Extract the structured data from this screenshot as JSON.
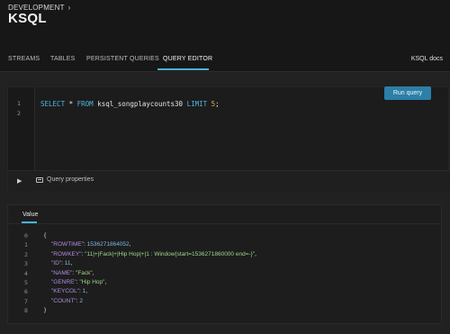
{
  "header": {
    "breadcrumb": "DEVELOPMENT",
    "title": "KSQL",
    "tabs": [
      {
        "label": "STREAMS"
      },
      {
        "label": "TABLES"
      },
      {
        "label": "PERSISTENT QUERIES"
      },
      {
        "label": "QUERY EDITOR"
      }
    ],
    "docs_label": "KSQL docs"
  },
  "editor": {
    "line_numbers": [
      "1",
      "2"
    ],
    "query_parts": {
      "kw1": "SELECT",
      "mid1": " * ",
      "kw2": "FROM",
      "table": " ksql_songplaycounts30 ",
      "kw3": "LIMIT",
      "space": " ",
      "limit": "5",
      "end": ";"
    },
    "query_properties_label": "Query properties",
    "run_label": "Run query"
  },
  "results": {
    "tab_label": "Value",
    "line_numbers": [
      "0",
      "1",
      "2",
      "3",
      "4",
      "5",
      "6",
      "7",
      "8"
    ],
    "lines": [
      {
        "text": "{"
      },
      {
        "key": "\"ROWTIME\"",
        "sep": ": ",
        "val": "1536271864052",
        "type": "n",
        "tail": ","
      },
      {
        "key": "\"ROWKEY\"",
        "sep": ": ",
        "val": "\"11|+|Fack|+|Hip Hop|+|1 : Window{start=1536271860000 end=-}\"",
        "type": "s",
        "tail": ","
      },
      {
        "key": "\"ID\"",
        "sep": ": ",
        "val": "11",
        "type": "n",
        "tail": ","
      },
      {
        "key": "\"NAME\"",
        "sep": ": ",
        "val": "\"Fack\"",
        "type": "s",
        "tail": ","
      },
      {
        "key": "\"GENRE\"",
        "sep": ": ",
        "val": "\"Hip Hop\"",
        "type": "s",
        "tail": ","
      },
      {
        "key": "\"KEYCOL\"",
        "sep": ": ",
        "val": "1",
        "type": "n",
        "tail": ","
      },
      {
        "key": "\"COUNT\"",
        "sep": ": ",
        "val": "2",
        "type": "n",
        "tail": ""
      },
      {
        "text": "}"
      }
    ]
  },
  "colors": {
    "accent": "#49b4d6",
    "run_button": "#2b7fa8",
    "keyword": "#4fb6df",
    "number_literal": "#d7b04f"
  },
  "icons": {
    "breadcrumb": "chevron-right-icon",
    "play": "play-icon",
    "properties": "query-properties-icon"
  }
}
